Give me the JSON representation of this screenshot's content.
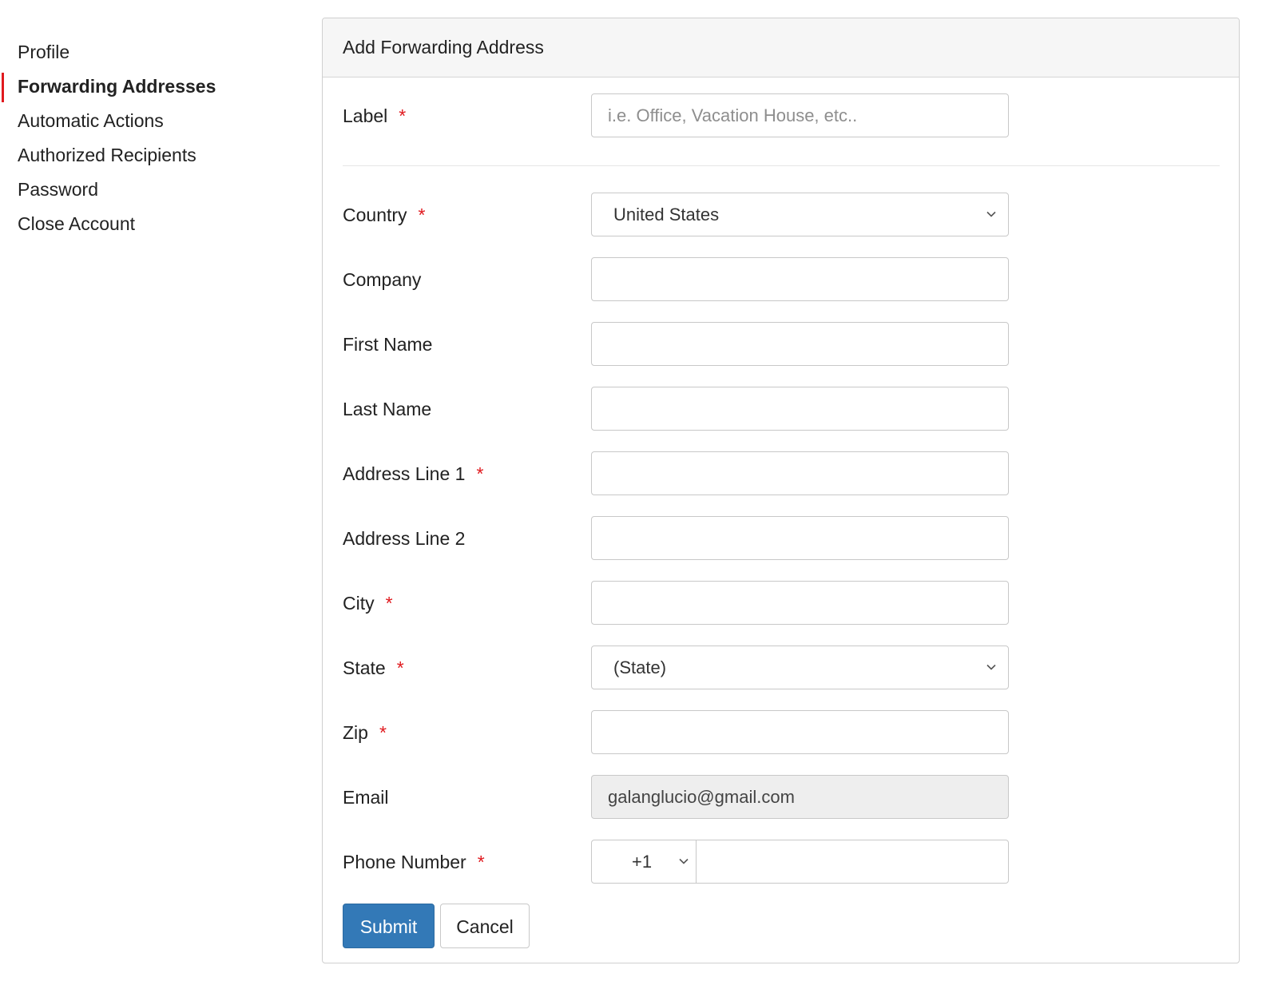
{
  "sidebar": {
    "items": [
      {
        "label": "Profile",
        "active": false
      },
      {
        "label": "Forwarding Addresses",
        "active": true
      },
      {
        "label": "Automatic Actions",
        "active": false
      },
      {
        "label": "Authorized Recipients",
        "active": false
      },
      {
        "label": "Password",
        "active": false
      },
      {
        "label": "Close Account",
        "active": false
      }
    ],
    "active_indicator_color": "#e0191e"
  },
  "form": {
    "title": "Add Forwarding Address",
    "required_marker": "*",
    "required_color": "#e0191e",
    "label": {
      "label": "Label",
      "value": "",
      "placeholder": "i.e. Office, Vacation House, etc.."
    },
    "country": {
      "label": "Country",
      "selected": "United States"
    },
    "company": {
      "label": "Company",
      "value": ""
    },
    "first_name": {
      "label": "First Name",
      "value": ""
    },
    "last_name": {
      "label": "Last Name",
      "value": ""
    },
    "address_line_1": {
      "label": "Address Line 1",
      "value": ""
    },
    "address_line_2": {
      "label": "Address Line 2",
      "value": ""
    },
    "city": {
      "label": "City",
      "value": ""
    },
    "state": {
      "label": "State",
      "selected": "(State)"
    },
    "zip": {
      "label": "Zip",
      "value": ""
    },
    "email": {
      "label": "Email",
      "value": "galanglucio@gmail.com"
    },
    "phone": {
      "label": "Phone Number",
      "country_code": "+1",
      "value": ""
    },
    "submit_label": "Submit",
    "cancel_label": "Cancel",
    "submit_color": "#3379b7"
  }
}
